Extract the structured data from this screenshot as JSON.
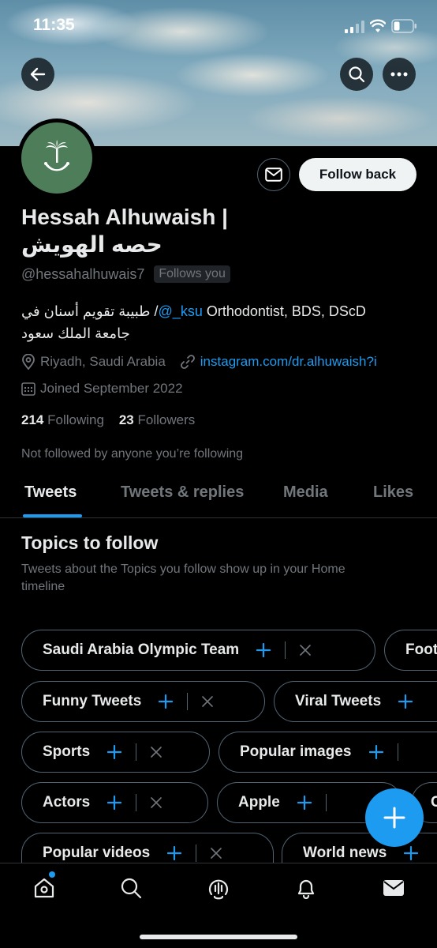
{
  "status_bar": {
    "time": "11:35"
  },
  "profile": {
    "name": "Hessah Alhuwaish |",
    "name_arabic": "حصه الهويش",
    "handle": "@hessahalhuwais7",
    "follows_you": "Follows you",
    "follow_button": "Follow back",
    "bio_prefix": "طبيبة تقويم أسنان في /",
    "bio_mention": "@_ksu",
    "bio_suffix": " Orthodontist, BDS, DScD",
    "bio_line2": "جامعة الملك سعود",
    "location": "Riyadh, Saudi Arabia",
    "website": "instagram.com/dr.alhuwaish?i",
    "joined": "Joined September 2022",
    "following_count": "214",
    "following_label": "Following",
    "followers_count": "23",
    "followers_label": "Followers",
    "not_followed": "Not followed by anyone you’re following"
  },
  "tabs": [
    {
      "label": "Tweets",
      "active": true
    },
    {
      "label": "Tweets & replies",
      "active": false
    },
    {
      "label": "Media",
      "active": false
    },
    {
      "label": "Likes",
      "active": false
    }
  ],
  "topics": {
    "title": "Topics to follow",
    "subtitle": "Tweets about the Topics you follow show up in your Home timeline",
    "chips": [
      "Saudi Arabia Olympic Team",
      "Foot",
      "Funny Tweets",
      "Viral Tweets",
      "Sports",
      "Popular images",
      "Actors",
      "Apple",
      "C",
      "Popular videos",
      "World news"
    ]
  },
  "colors": {
    "accent": "#1d9bf0",
    "background": "#000000",
    "avatar_bg": "#4d7d59"
  },
  "icons": {
    "back": "arrow-left-icon",
    "search": "search-icon",
    "more": "more-dots-icon",
    "mail": "mail-icon",
    "location": "location-pin-icon",
    "link": "link-icon",
    "calendar": "calendar-icon",
    "compose": "plus-icon",
    "nav": [
      "home-icon",
      "search-icon",
      "spaces-icon",
      "bell-icon",
      "mail-icon"
    ]
  }
}
